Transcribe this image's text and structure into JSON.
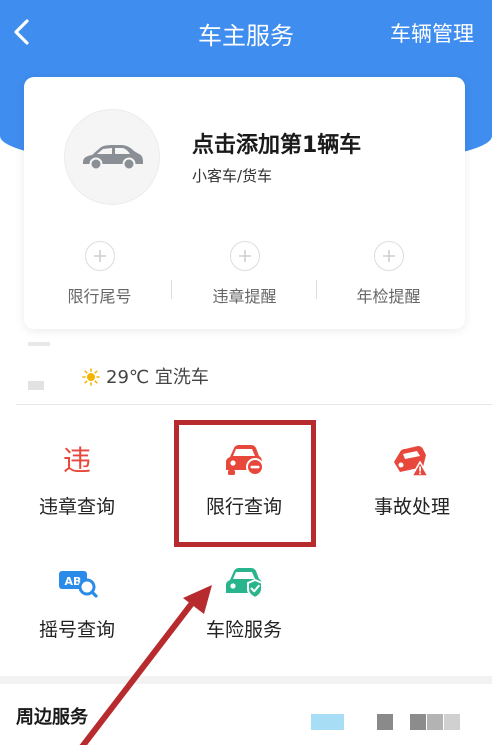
{
  "header": {
    "title": "车主服务",
    "right_action": "车辆管理",
    "back_icon": "chevron-left-icon"
  },
  "vehicle_card": {
    "title": "点击添加第1辆车",
    "subtitle": "小客车/货车",
    "quick_actions": [
      {
        "label": "限行尾号",
        "icon": "plus-icon"
      },
      {
        "label": "违章提醒",
        "icon": "plus-icon"
      },
      {
        "label": "年检提醒",
        "icon": "plus-icon"
      }
    ]
  },
  "weather": {
    "icon": "sun-icon",
    "text": "29℃ 宜洗车"
  },
  "services": [
    {
      "label": "违章查询",
      "icon": "violation-icon",
      "icon_text": "违"
    },
    {
      "label": "限行查询",
      "icon": "restricted-car-icon"
    },
    {
      "label": "事故处理",
      "icon": "accident-icon"
    },
    {
      "label": "摇号查询",
      "icon": "lottery-search-icon",
      "icon_text": "AB"
    },
    {
      "label": "车险服务",
      "icon": "insurance-car-icon"
    }
  ],
  "nearby": {
    "title": "周边服务"
  },
  "colors": {
    "primary": "#3f8dee",
    "service_red": "#e8483c",
    "highlight": "#b72b2e",
    "lottery_blue": "#2b8be8",
    "insurance_green": "#28b48c"
  }
}
